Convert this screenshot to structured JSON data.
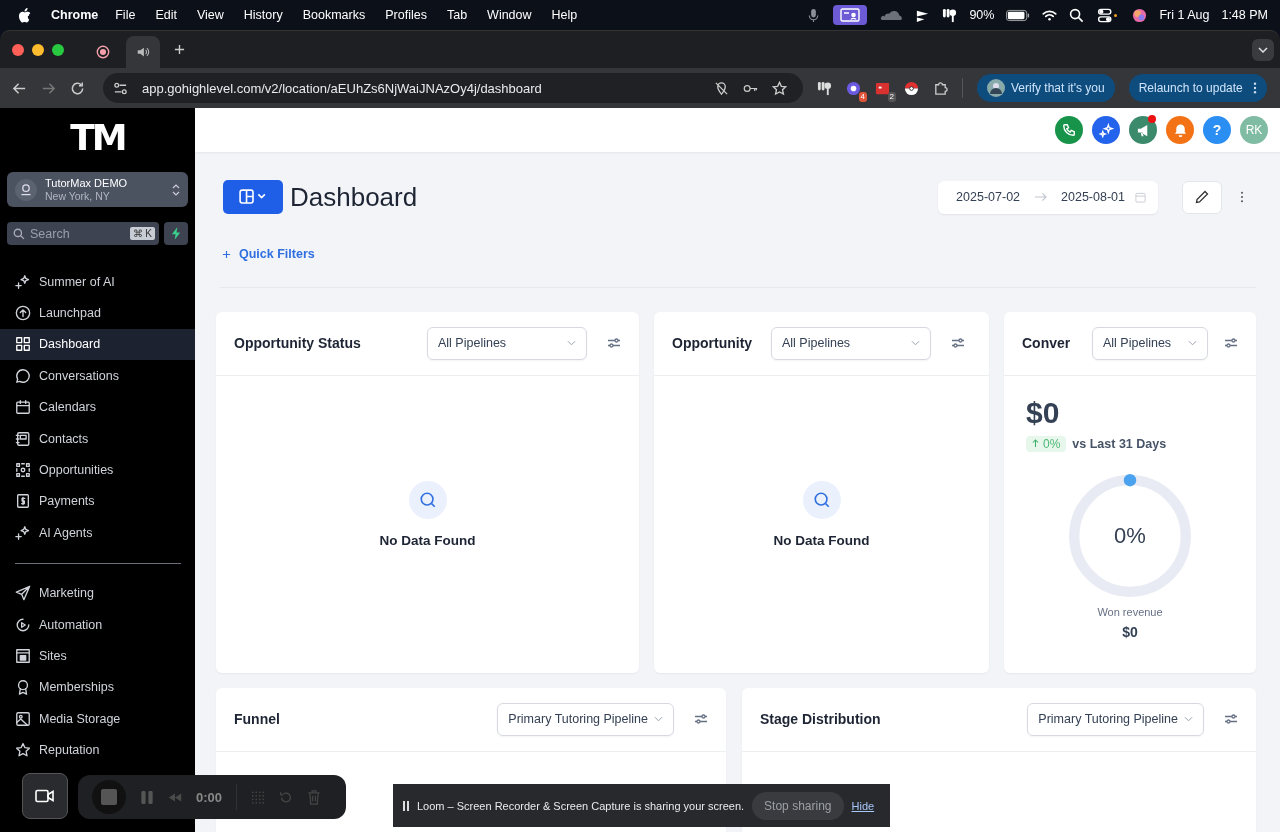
{
  "menubar": {
    "app": "Chrome",
    "menus": [
      "File",
      "Edit",
      "View",
      "History",
      "Bookmarks",
      "Profiles",
      "Tab",
      "Window",
      "Help"
    ],
    "battery": "90%",
    "date": "Fri 1 Aug",
    "time": "1:48 PM"
  },
  "browser": {
    "tabs": [
      {
        "kind": "recording",
        "selected": false
      },
      {
        "kind": "audio",
        "selected": true
      }
    ],
    "url": "app.gohighlevel.com/v2/location/aEUhZs6NjWaiJNAzOy4j/dashboard",
    "badges": [
      "4",
      "2"
    ],
    "verify": "Verify that it's you",
    "relaunch": "Relaunch to update"
  },
  "sidebar": {
    "logo": "TM",
    "account": {
      "name": "TutorMax DEMO",
      "location": "New York, NY"
    },
    "search": {
      "placeholder": "Search",
      "shortcut": "⌘ K"
    },
    "groups": [
      [
        {
          "label": "Summer of AI",
          "selected": false
        },
        {
          "label": "Launchpad",
          "selected": false
        },
        {
          "label": "Dashboard",
          "selected": true
        },
        {
          "label": "Conversations",
          "selected": false
        },
        {
          "label": "Calendars",
          "selected": false
        },
        {
          "label": "Contacts",
          "selected": false
        },
        {
          "label": "Opportunities",
          "selected": false
        },
        {
          "label": "Payments",
          "selected": false
        },
        {
          "label": "AI Agents",
          "selected": false
        }
      ],
      [
        {
          "label": "Marketing",
          "selected": false
        },
        {
          "label": "Automation",
          "selected": false
        },
        {
          "label": "Sites",
          "selected": false
        },
        {
          "label": "Memberships",
          "selected": false
        },
        {
          "label": "Media Storage",
          "selected": false
        },
        {
          "label": "Reputation",
          "selected": false
        }
      ]
    ]
  },
  "topbar": {
    "help": "?",
    "avatar": "RK",
    "announcement_dot": true
  },
  "page": {
    "title": "Dashboard",
    "date_from": "2025-07-02",
    "date_to": "2025-08-01",
    "quick_filters": "Quick Filters"
  },
  "cards": [
    {
      "kind": "empty",
      "title": "Opportunity Status",
      "select": "All Pipelines",
      "message": "No Data Found"
    },
    {
      "kind": "empty",
      "title": "Opportunity",
      "select": "All Pipelines",
      "message": "No Data Found"
    },
    {
      "kind": "conversion",
      "title": "Conver",
      "select": "All Pipelines",
      "value": "$0",
      "change": "0%",
      "comparison": "vs Last 31 Days",
      "percent": "0%",
      "caption": "Won revenue",
      "caption_value": "$0"
    }
  ],
  "cards_bottom": [
    {
      "title": "Funnel",
      "select": "Primary Tutoring Pipeline"
    },
    {
      "title": "Stage Distribution",
      "select": "Primary Tutoring Pipeline"
    }
  ],
  "loom": {
    "timer": "0:00",
    "banner": "Loom – Screen Recorder & Screen Capture is sharing your screen.",
    "stop": "Stop sharing",
    "hide": "Hide"
  }
}
